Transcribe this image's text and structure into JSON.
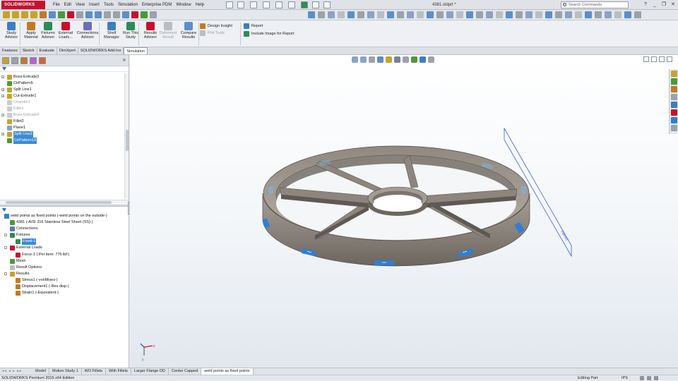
{
  "app": {
    "logo_text": "SOLIDWORKS",
    "document_title": "4381.sldprt *"
  },
  "menu": [
    "File",
    "Edit",
    "View",
    "Insert",
    "Tools",
    "Simulation",
    "Enterprise PDM",
    "Window",
    "Help"
  ],
  "search": {
    "placeholder": "Search Commands"
  },
  "window_controls": {
    "help": "?",
    "minimize": "_",
    "restore": "❐",
    "close": "✕"
  },
  "ribbon": {
    "buttons": [
      {
        "id": "study-advisor",
        "line1": "Study",
        "line2": "Advisor",
        "color": "#3a7fc1",
        "disabled": false
      },
      {
        "id": "apply-material",
        "line1": "Apply",
        "line2": "Material",
        "color": "#c07a28",
        "disabled": false
      },
      {
        "id": "fixtures-advisor",
        "line1": "Fixtures",
        "line2": "Advisor",
        "color": "#2e8b57",
        "disabled": false
      },
      {
        "id": "external-loads",
        "line1": "External",
        "line2": "Loads...",
        "color": "#c8102e",
        "disabled": false
      },
      {
        "id": "connections-advisor",
        "line1": "Connections",
        "line2": "Advisor",
        "color": "#6b6fb5",
        "disabled": false
      },
      {
        "id": "shell-manager",
        "line1": "Shell",
        "line2": "Manager",
        "color": "#3a7fc1",
        "disabled": false
      },
      {
        "id": "run-this-study",
        "line1": "Run This",
        "line2": "Study",
        "color": "#2e8b57",
        "disabled": false
      },
      {
        "id": "results-advisor",
        "line1": "Results",
        "line2": "Advisor",
        "color": "#c8102e",
        "disabled": false
      },
      {
        "id": "deformed-result",
        "line1": "Deformed",
        "line2": "Result",
        "color": "#b9bec5",
        "disabled": true
      },
      {
        "id": "compare-results",
        "line1": "Compare",
        "line2": "Results",
        "color": "#5b8fc9",
        "disabled": false
      }
    ],
    "small": [
      {
        "id": "design-insight",
        "label": "Design Insight",
        "color": "#c07a28",
        "disabled": false
      },
      {
        "id": "plot-tools",
        "label": "Plot Tools",
        "color": "#b9bec5",
        "disabled": true
      },
      {
        "id": "report",
        "label": "Report",
        "color": "#3a7fc1",
        "disabled": false
      },
      {
        "id": "include-image",
        "label": "Include Image for Report",
        "color": "#2e8b57",
        "disabled": false
      }
    ]
  },
  "tabs": [
    {
      "label": "Features",
      "active": false
    },
    {
      "label": "Sketch",
      "active": false
    },
    {
      "label": "Evaluate",
      "active": false
    },
    {
      "label": "DimXpert",
      "active": false
    },
    {
      "label": "SOLIDWORKS Add-Ins",
      "active": false
    },
    {
      "label": "Simulation",
      "active": true
    }
  ],
  "feature_tree": [
    {
      "label": "Boss-Extrude3",
      "icon": "extrude-icon",
      "color": "#c9a227",
      "expand": "+",
      "state": "normal"
    },
    {
      "label": "CirPattern5",
      "icon": "pattern-icon",
      "color": "#4a9a3a",
      "expand": "",
      "state": "normal"
    },
    {
      "label": "Split Line1",
      "icon": "split-line-icon",
      "color": "#c9a227",
      "expand": "+",
      "state": "normal"
    },
    {
      "label": "Cut-Extrude1",
      "icon": "cut-icon",
      "color": "#c9a227",
      "expand": "+",
      "state": "normal"
    },
    {
      "label": "Chamfer1",
      "icon": "chamfer-icon",
      "color": "#c8ccd2",
      "expand": "",
      "state": "grey"
    },
    {
      "label": "Fillet1",
      "icon": "fillet-icon",
      "color": "#c8ccd2",
      "expand": "",
      "state": "grey"
    },
    {
      "label": "Boss-Extrude4",
      "icon": "extrude-icon",
      "color": "#c8ccd2",
      "expand": "+",
      "state": "grey"
    },
    {
      "label": "Fillet2",
      "icon": "fillet-icon",
      "color": "#c9a227",
      "expand": "",
      "state": "normal"
    },
    {
      "label": "Plane1",
      "icon": "plane-icon",
      "color": "#8aa2c8",
      "expand": "",
      "state": "normal"
    },
    {
      "label": "Split Line2",
      "icon": "split-line-icon",
      "color": "#c9a227",
      "expand": "+",
      "state": "selected"
    },
    {
      "label": "CirPattern13",
      "icon": "pattern-icon",
      "color": "#4a9a3a",
      "expand": "",
      "state": "selected"
    }
  ],
  "sim_tree": [
    {
      "label": "weld points as fixed points (-weld points on the outside-)",
      "indent": 0,
      "icon": "study-icon",
      "color": "#3a7fc1",
      "expand": "",
      "state": "normal"
    },
    {
      "label": "4381 (-AISI 316 Stainless Steel Sheet (SS)-)",
      "indent": 1,
      "icon": "part-icon",
      "color": "#4a9a3a",
      "expand": "",
      "state": "normal"
    },
    {
      "label": "Connections",
      "indent": 1,
      "icon": "connections-icon",
      "color": "#6b6fb5",
      "expand": "",
      "state": "normal"
    },
    {
      "label": "Fixtures",
      "indent": 1,
      "icon": "fixtures-icon",
      "color": "#2e8b57",
      "expand": "-",
      "state": "normal"
    },
    {
      "label": "Fixed-1",
      "indent": 2,
      "icon": "fixed-icon",
      "color": "#2e8b57",
      "expand": "",
      "state": "selected"
    },
    {
      "label": "External Loads",
      "indent": 1,
      "icon": "loads-icon",
      "color": "#c8102e",
      "expand": "-",
      "state": "normal"
    },
    {
      "label": "Force-1 (:Per item: 776 lbf:)",
      "indent": 2,
      "icon": "force-icon",
      "color": "#c8102e",
      "expand": "",
      "state": "normal"
    },
    {
      "label": "Mesh",
      "indent": 1,
      "icon": "mesh-icon",
      "color": "#4a9a3a",
      "expand": "",
      "state": "normal"
    },
    {
      "label": "Result Options",
      "indent": 1,
      "icon": "result-options-icon",
      "color": "#b9bec5",
      "expand": "",
      "state": "normal"
    },
    {
      "label": "Results",
      "indent": 1,
      "icon": "results-folder-icon",
      "color": "#c9a227",
      "expand": "-",
      "state": "normal"
    },
    {
      "label": "Stress1 (-vonMises-)",
      "indent": 2,
      "icon": "stress-plot-icon",
      "color": "#c07a28",
      "expand": "",
      "state": "normal"
    },
    {
      "label": "Displacement1 (-Res disp-)",
      "indent": 2,
      "icon": "displacement-plot-icon",
      "color": "#c07a28",
      "expand": "",
      "state": "normal"
    },
    {
      "label": "Strain1 (-Equivalent-)",
      "indent": 2,
      "icon": "strain-plot-icon",
      "color": "#c07a28",
      "expand": "",
      "state": "normal"
    }
  ],
  "sheet_tabs": [
    {
      "label": "Model",
      "active": false
    },
    {
      "label": "Motion Study 1",
      "active": false
    },
    {
      "label": "WO Fillets",
      "active": false
    },
    {
      "label": "With Fillets",
      "active": false
    },
    {
      "label": "Larger Flange OD",
      "active": false
    },
    {
      "label": "Center Capped",
      "active": false
    },
    {
      "label": "weld points as fixed points",
      "active": true
    }
  ],
  "sheet_nav": "◂◂ ◂ ▸ ▸▸",
  "status": {
    "left": "SOLIDWORKS Premium 2015 x64 Edition",
    "mode": "Editing Part",
    "units": "IPS"
  },
  "colors": {
    "part": "#9b948c",
    "part_dark": "#6f6962",
    "split_face": "#2f7fd6",
    "plane": "#3b5bdb",
    "selection": "#3b8bd8"
  },
  "triad": {
    "x": "x",
    "y": "y"
  }
}
